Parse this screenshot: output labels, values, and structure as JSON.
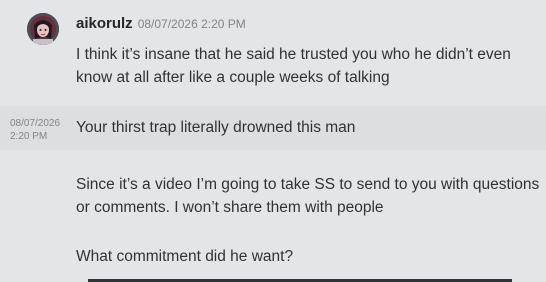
{
  "author": {
    "username": "aikorulz",
    "timestamp": "08/07/2026 2:20 PM",
    "avatar_icon": "user-avatar"
  },
  "messages": [
    {
      "text": "I think it’s insane that he said he trusted you who he didn’t even know at all after like a couple weeks of talking"
    },
    {
      "side_time_date": "08/07/2026",
      "side_time_clock": "2:20 PM",
      "text": "Your thirst trap literally drowned this man"
    },
    {
      "text": "Since it’s a video I’m going to take SS to send to you with questions or comments. I won’t share them with people"
    },
    {
      "text": "What commitment did he want?"
    }
  ],
  "colors": {
    "background": "#e3e5e8",
    "hover_row": "#dcdee1",
    "username": "#23272a",
    "timestamp": "#80858c"
  }
}
